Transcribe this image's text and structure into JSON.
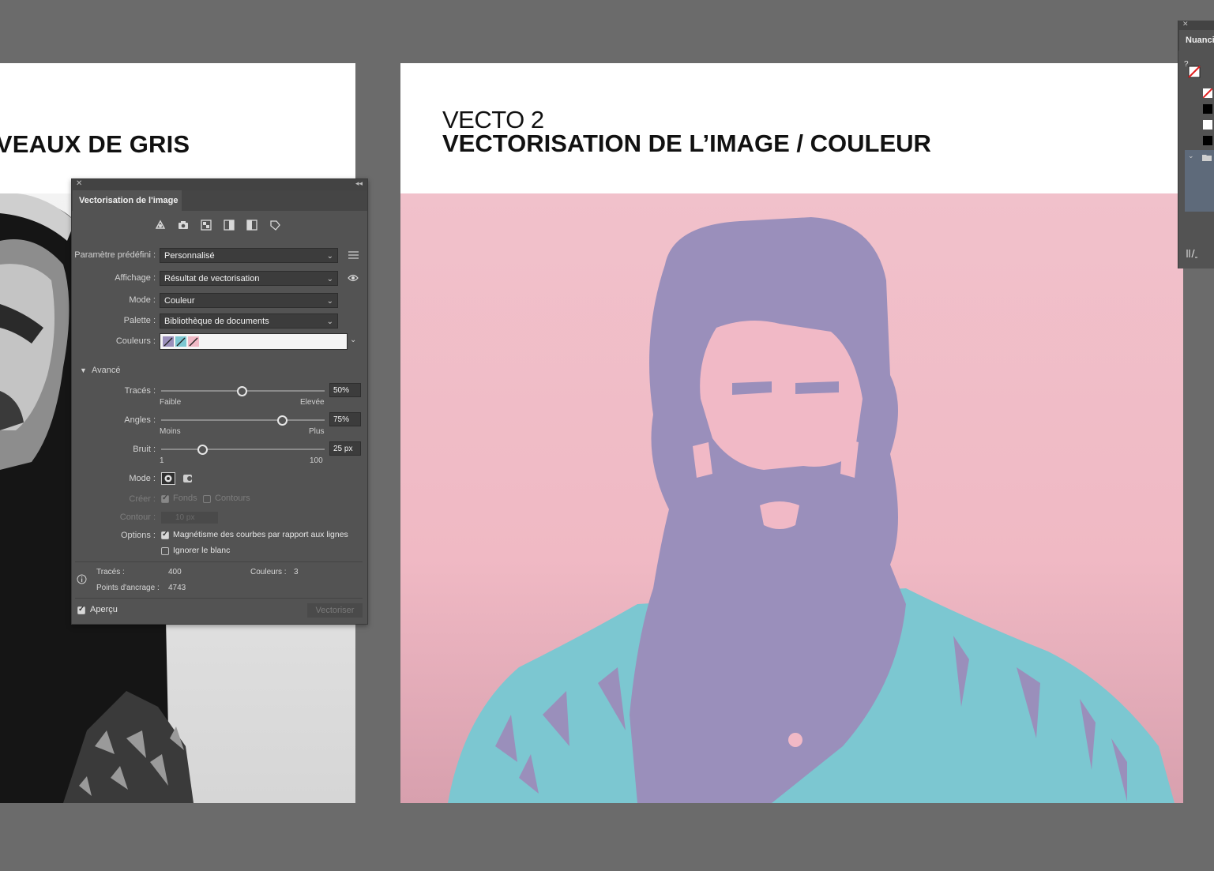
{
  "artboards": {
    "left": {
      "title_bold": "IVEAUX DE GRIS"
    },
    "right": {
      "title_thin": "VECTO 2",
      "title_bold": "VECTORISATION DE L’IMAGE / COULEUR"
    }
  },
  "trace_panel": {
    "tab_label": "Vectorisation de l'image",
    "preset_icons": [
      "auto-color-icon",
      "high-color-icon",
      "low-color-icon",
      "grayscale-icon",
      "black-white-icon",
      "outline-icon"
    ],
    "preset": {
      "label": "Paramètre prédéfini :",
      "value": "Personnalisé"
    },
    "view": {
      "label": "Affichage :",
      "value": "Résultat de vectorisation"
    },
    "mode": {
      "label": "Mode :",
      "value": "Couleur"
    },
    "palette": {
      "label": "Palette :",
      "value": "Bibliothèque de documents"
    },
    "colors": {
      "label": "Couleurs :",
      "swatches": [
        "#9a8fbb",
        "#7cc7d1",
        "#f1b9c6"
      ]
    },
    "advanced": {
      "label": "Avancé",
      "paths": {
        "label": "Tracés :",
        "value": "50%",
        "level": 0.5,
        "min_label": "Faible",
        "max_label": "Elevée"
      },
      "corners": {
        "label": "Angles :",
        "value": "75%",
        "level": 0.75,
        "min_label": "Moins",
        "max_label": "Plus"
      },
      "noise": {
        "label": "Bruit :",
        "value": "25 px",
        "level": 0.24,
        "min_label": "1",
        "max_label": "100"
      },
      "method_label": "Mode :",
      "create": {
        "label": "Créer :",
        "fills": "Fonds",
        "strokes": "Contours",
        "fills_checked": true,
        "strokes_checked": false
      },
      "stroke": {
        "label": "Contour :",
        "value": "10 px"
      },
      "options": {
        "label": "Options :",
        "snap_curves": "Magnétisme des courbes par rapport aux lignes",
        "snap_checked": true,
        "ignore_white": "Ignorer le blanc",
        "ignore_checked": false
      }
    },
    "info": {
      "paths_label": "Tracés :",
      "paths_value": "400",
      "colors_label": "Couleurs :",
      "colors_value": "3",
      "anchors_label": "Points d'ancrage :",
      "anchors_value": "4743"
    },
    "preview": {
      "label": "Aperçu",
      "checked": true
    },
    "trace_button": "Vectoriser"
  },
  "swatch_panel": {
    "tab_label": "Nuancier"
  },
  "colors": {
    "canvas": "#6b6b6b",
    "panel_bg": "#535353",
    "pink": "#f1b9c6",
    "purple": "#9a8fbb",
    "teal": "#7cc7d1"
  }
}
